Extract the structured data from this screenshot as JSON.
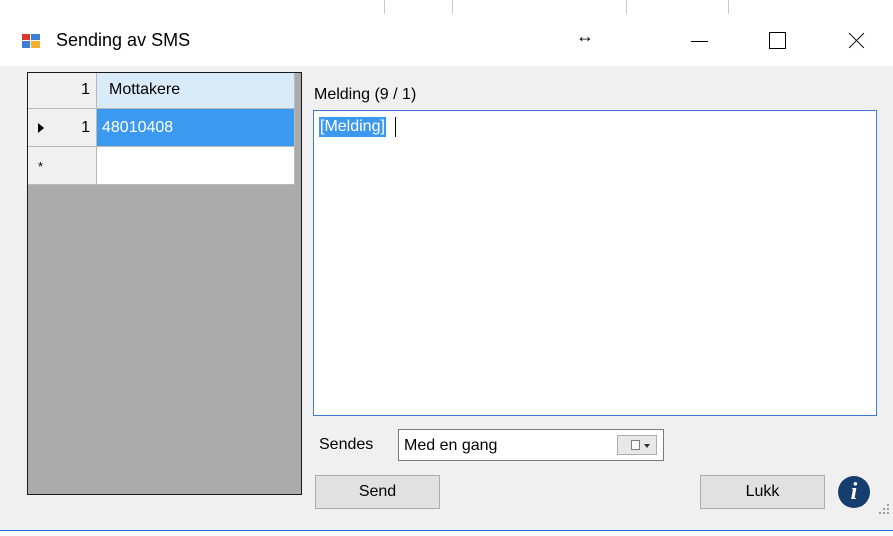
{
  "window": {
    "title": "Sending av SMS",
    "resize_cursor_glyph": "↔"
  },
  "grid": {
    "header_count": "1",
    "column_header": "Mottakere",
    "rows": [
      {
        "number": "1",
        "value": "48010408",
        "selected": true
      }
    ],
    "new_row_marker": "*"
  },
  "message": {
    "label": "Melding (9 / 1)",
    "text": "[Melding]"
  },
  "sendes": {
    "label": "Sendes",
    "selected": "Med en gang"
  },
  "buttons": {
    "send": "Send",
    "lukk": "Lukk"
  },
  "icons": {
    "info": "i"
  },
  "colors": {
    "selection": "#3c99f0",
    "header_highlight": "#d9ebf9",
    "grid_background": "#ababab",
    "info_icon": "#153d6e"
  }
}
